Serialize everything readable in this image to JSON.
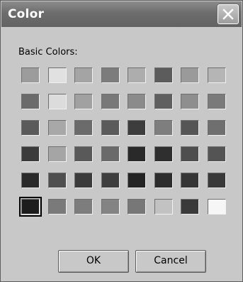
{
  "window": {
    "title": "Color"
  },
  "dialog": {
    "basic_colors_label": "Basic Colors:",
    "ok_label": "OK",
    "cancel_label": "Cancel"
  },
  "swatches": [
    [
      "#9c9c9c",
      "#e1e1e1",
      "#a4a4a4",
      "#7c7c7c",
      "#adadad",
      "#5c5c5c",
      "#9a9a9a",
      "#b5b5b5"
    ],
    [
      "#6b6b6b",
      "#dcdcdc",
      "#a1a1a1",
      "#787878",
      "#8b8b8b",
      "#5f5f5f",
      "#8e8e8e",
      "#7a7a7a"
    ],
    [
      "#5a5a5a",
      "#a8a8a8",
      "#6b6b6b",
      "#5b5b5b",
      "#3d3d3d",
      "#7e7e7e",
      "#555555",
      "#6f6f6f"
    ],
    [
      "#3b3b3b",
      "#a5a5a5",
      "#595959",
      "#6a6a6a",
      "#2a2a2a",
      "#2f2f2f",
      "#4e4e4e",
      "#545454"
    ],
    [
      "#2a2a2a",
      "#4f4f4f",
      "#3b3b3b",
      "#3f3f3f",
      "#242424",
      "#2d2d2d",
      "#363636",
      "#393939"
    ],
    [
      "#1d1d1d",
      "#7a7a7a",
      "#7d7d7d",
      "#838383",
      "#777777",
      "#c2c2c2",
      "#3a3a3a",
      "#f6f6f6"
    ]
  ],
  "selected": {
    "row": 5,
    "col": 0
  }
}
